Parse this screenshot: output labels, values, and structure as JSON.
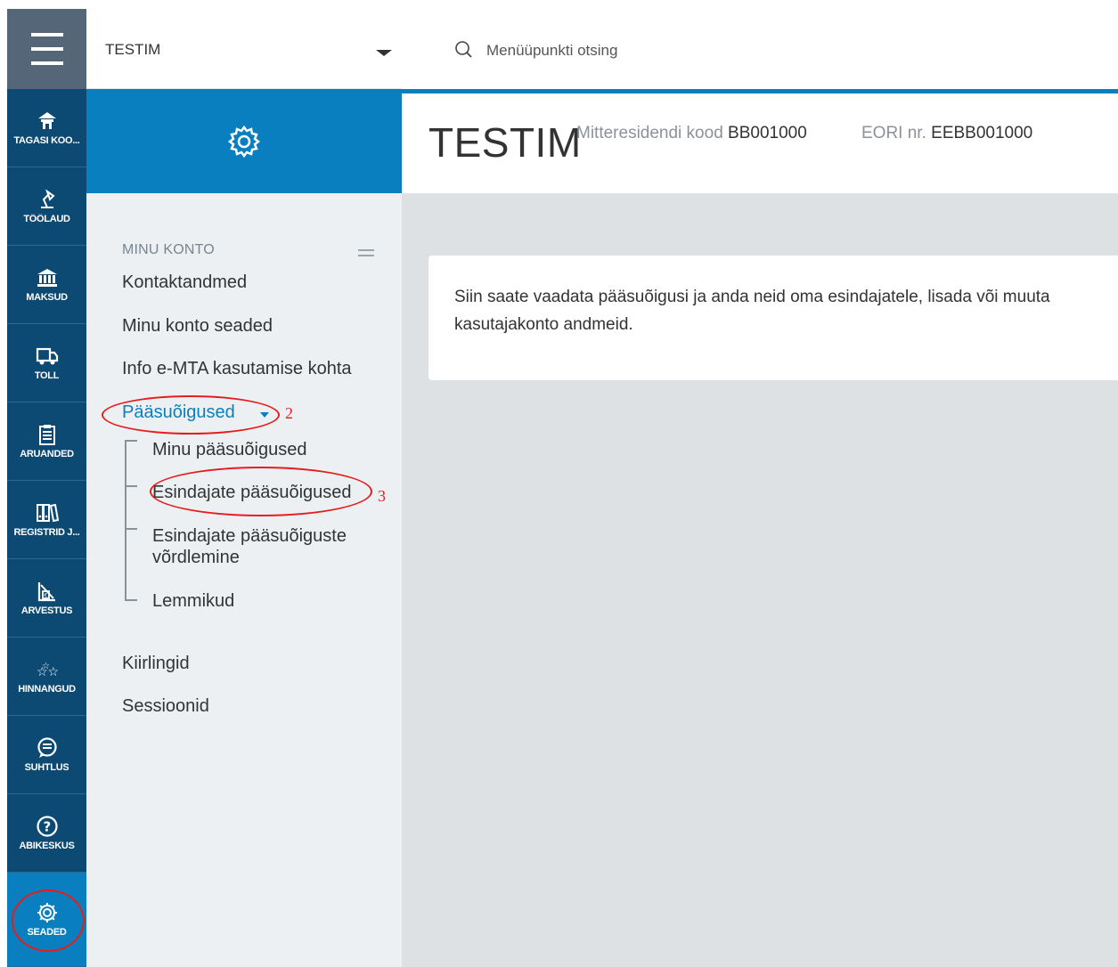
{
  "rail": {
    "menu_icon": "hamburger-icon",
    "items": [
      {
        "label": "TAGASI KOO...",
        "icon": "house-icon"
      },
      {
        "label": "TÖÖLAUD",
        "icon": "desk-lamp-icon"
      },
      {
        "label": "MAKSUD",
        "icon": "bank-icon"
      },
      {
        "label": "TOLL",
        "icon": "truck-icon"
      },
      {
        "label": "ARUANDED",
        "icon": "clipboard-icon"
      },
      {
        "label": "REGISTRID J...",
        "icon": "binders-icon"
      },
      {
        "label": "ARVESTUS",
        "icon": "calculator-icon"
      },
      {
        "label": "HINNANGUD",
        "icon": "stars-icon"
      },
      {
        "label": "SUHTLUS",
        "icon": "chat-icon"
      },
      {
        "label": "ABIKESKUS",
        "icon": "help-icon"
      },
      {
        "label": "SEADED",
        "icon": "gear-icon"
      }
    ]
  },
  "context": {
    "name": "TESTIM"
  },
  "search": {
    "placeholder": "Menüüpunkti otsing"
  },
  "sidebar": {
    "section_title": "MINU KONTO",
    "items": [
      {
        "label": "Kontaktandmed"
      },
      {
        "label": "Minu konto seaded"
      },
      {
        "label": "Info e-MTA kasutamise kohta"
      },
      {
        "label": "Pääsuõigused"
      },
      {
        "label": "Kiirlingid"
      },
      {
        "label": "Sessioonid"
      }
    ],
    "subitems": [
      {
        "label": "Minu pääsuõigused"
      },
      {
        "label": "Esindajate pääsuõigused"
      },
      {
        "label": "Esindajate pääsuõiguste võrdlemine"
      },
      {
        "label": "Lemmikud"
      }
    ]
  },
  "header": {
    "title": "TESTIM",
    "nonresident_label": "Mitteresidendi kood",
    "nonresident_code": "BB001000",
    "eori_label": "EORI nr.",
    "eori_code": "EEBB001000"
  },
  "content": {
    "line1": "Siin saate vaadata pääsuõigusi ja anda neid oma esindajatele, lisada või muuta",
    "line2": "kasutajakonto andmeid."
  },
  "annotations": {
    "step2": "2",
    "step3": "3"
  },
  "colors": {
    "rail": "#0c4a73",
    "accent": "#0a7fbf",
    "annotation": "#e41e1e"
  }
}
